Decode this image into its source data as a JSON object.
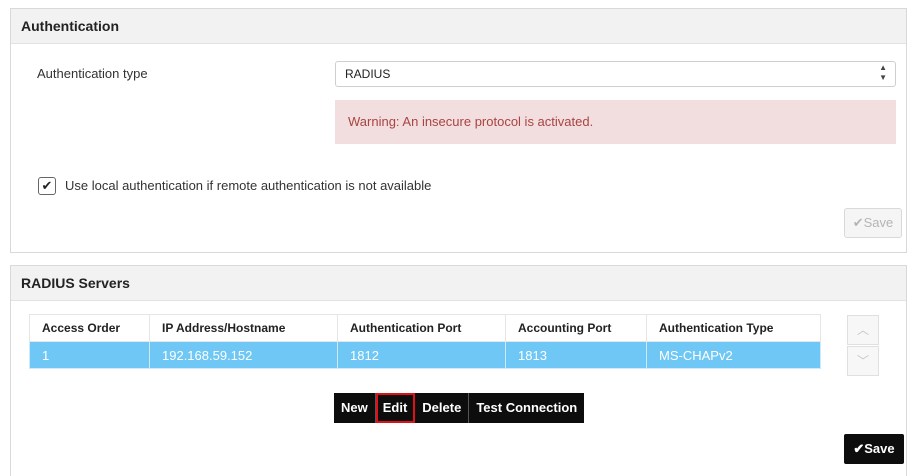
{
  "auth_panel": {
    "title": "Authentication",
    "auth_type_label": "Authentication type",
    "auth_type_selected": "RADIUS",
    "warning": "Warning: An insecure protocol is activated.",
    "local_auth_checked": true,
    "local_auth_label": "Use local authentication if remote authentication is not available",
    "save_label": "Save",
    "save_enabled": false
  },
  "radius_panel": {
    "title": "RADIUS Servers",
    "columns": [
      "Access Order",
      "IP Address/Hostname",
      "Authentication Port",
      "Accounting Port",
      "Authentication Type"
    ],
    "rows": [
      [
        "1",
        "192.168.59.152",
        "1812",
        "1813",
        "MS-CHAPv2"
      ]
    ],
    "buttons": {
      "new": "New",
      "edit": "Edit",
      "delete": "Delete",
      "test": "Test Connection"
    },
    "save_label": "Save"
  },
  "icons": {
    "check": "check-icon",
    "select_arrows": "select-arrows-icon",
    "move_up": "chevron-up-icon",
    "move_down": "chevron-down-icon"
  },
  "colors": {
    "selected_row": "#6ec7f5",
    "warning_bg": "#f2dede",
    "warning_text": "#a94442",
    "highlight_outline": "#e0101a"
  }
}
